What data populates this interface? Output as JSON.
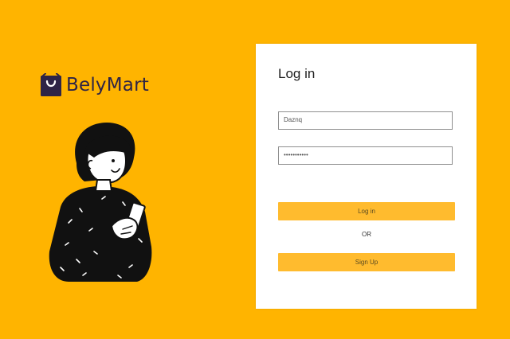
{
  "brand": {
    "name": "BelyMart",
    "icon": "shopping-bag-icon"
  },
  "illustration": {
    "icon": "woman-with-phone-illustration"
  },
  "login_card": {
    "title": "Log in",
    "username_value": "Daznq",
    "password_value": "•••••••••••",
    "login_button_label": "Log in",
    "separator_text": "OR",
    "signup_button_label": "Sign Up"
  },
  "colors": {
    "background": "#FFB400",
    "button": "#FFBB2E",
    "card": "#FFFFFF",
    "brand_text": "#2E2446"
  }
}
